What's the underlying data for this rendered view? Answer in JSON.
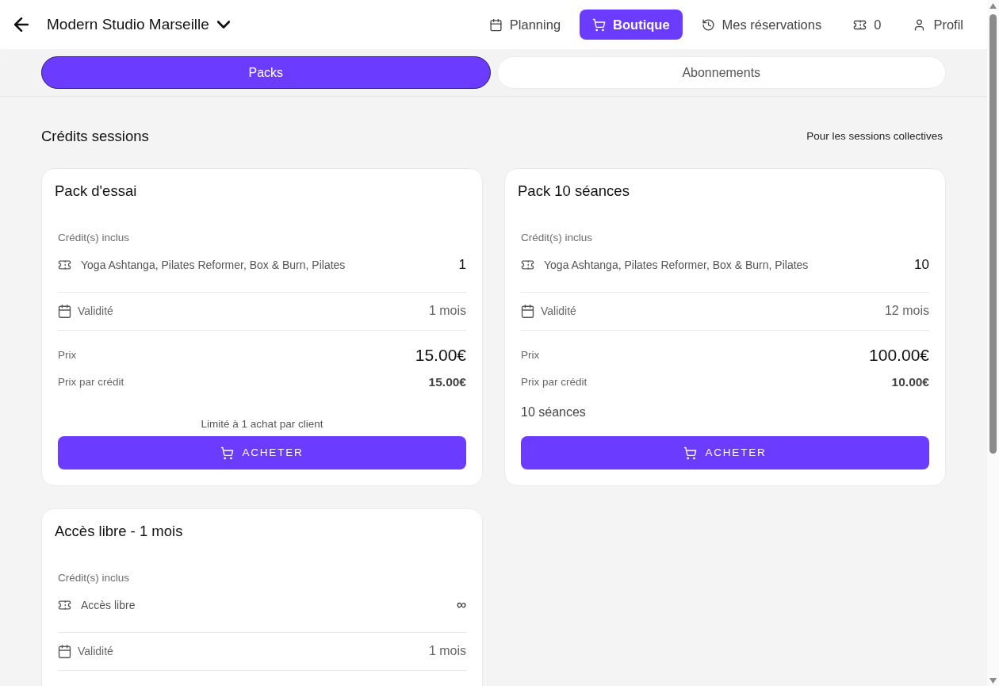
{
  "header": {
    "studio_name": "Modern Studio Marseille",
    "nav": [
      {
        "label": "Planning",
        "selected": false
      },
      {
        "label": "Boutique",
        "selected": true
      },
      {
        "label": "Mes réservations",
        "selected": false
      }
    ],
    "credit_balance": "0",
    "profile_label": "Profil"
  },
  "tabs": [
    {
      "label": "Packs",
      "selected": true
    },
    {
      "label": "Abonnements",
      "selected": false
    }
  ],
  "section": {
    "title": "Crédits sessions",
    "subtitle": "Pour les sessions collectives"
  },
  "products": [
    {
      "title": "Pack d'essai",
      "credits_label": "Crédit(s) inclus",
      "credits": [
        {
          "name": "Yoga Ashtanga, Pilates Reformer, Box & Burn, Pilates",
          "count": "1"
        }
      ],
      "validity_label": "Validité",
      "validity": "1 mois",
      "price_label": "Prix",
      "price": "15.00€",
      "unit_price_label": "Prix par crédit",
      "unit_price": "15.00€",
      "limit": "Limité à 1 achat par client",
      "buy_label": "ACHETER"
    },
    {
      "title": "Pack 10 séances",
      "credits_label": "Crédit(s) inclus",
      "credits": [
        {
          "name": "Yoga Ashtanga, Pilates Reformer, Box & Burn, Pilates",
          "count": "10"
        }
      ],
      "validity_label": "Validité",
      "validity": "12 mois",
      "price_label": "Prix",
      "price": "100.00€",
      "unit_price_label": "Prix par crédit",
      "unit_price": "10.00€",
      "description": "10 séances",
      "buy_label": "ACHETER"
    },
    {
      "title": "Accès libre - 1 mois",
      "credits_label": "Crédit(s) inclus",
      "credits": [
        {
          "name": "Accès libre",
          "count": "∞"
        }
      ],
      "validity_label": "Validité",
      "validity": "1 mois"
    }
  ]
}
